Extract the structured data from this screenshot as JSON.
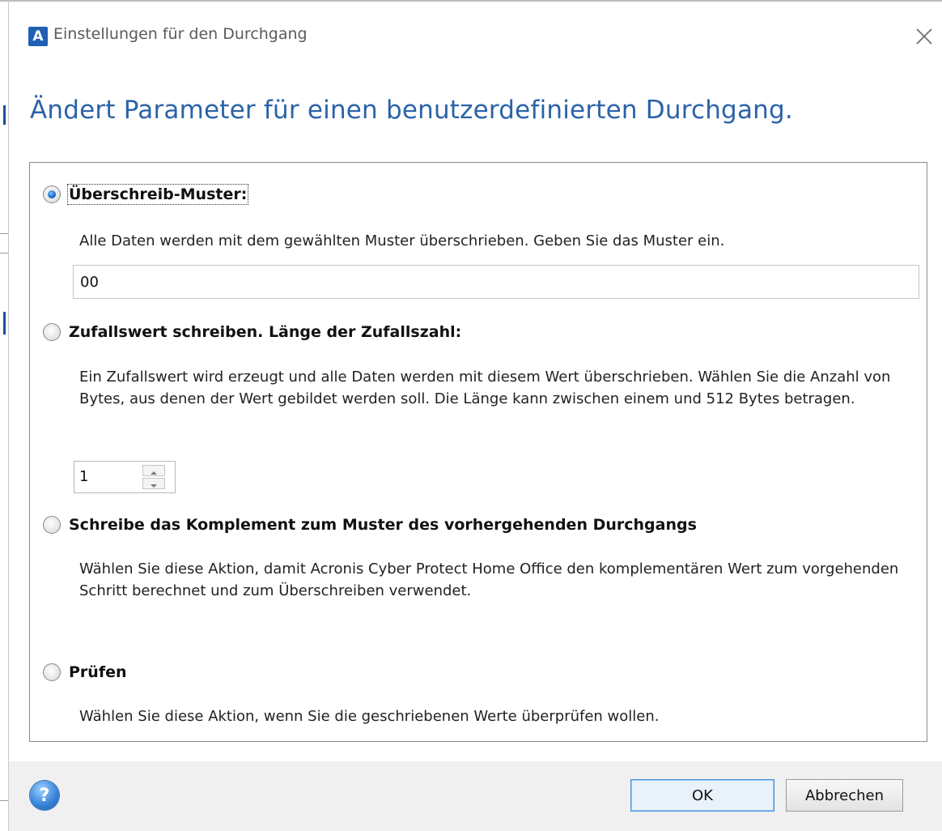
{
  "window": {
    "app_icon_letter": "A",
    "title": "Einstellungen für den Durchgang",
    "close_glyph": "×"
  },
  "heading": "Ändert Parameter für einen benutzerdefinierten Durchgang.",
  "options": [
    {
      "label": "Überschreib-Muster:",
      "selected": true,
      "description": "Alle Daten werden mit dem gewählten Muster überschrieben. Geben Sie das Muster ein."
    },
    {
      "label": "Zufallswert schreiben. Länge der Zufallszahl:",
      "selected": false,
      "description": "Ein Zufallswert wird erzeugt und alle Daten werden mit diesem Wert überschrieben. Wählen Sie die Anzahl von Bytes, aus denen der Wert gebildet werden soll. Die Länge kann zwischen einem und 512 Bytes betragen."
    },
    {
      "label": "Schreibe das Komplement zum Muster des vorhergehenden Durchgangs",
      "selected": false,
      "description": "Wählen Sie diese Aktion, damit Acronis Cyber Protect Home Office den komplementären Wert zum vorgehenden Schritt berechnet und zum Überschreiben verwendet."
    },
    {
      "label": "Prüfen",
      "selected": false,
      "description": "Wählen Sie diese Aktion, wenn Sie die geschriebenen Werte überprüfen wollen."
    }
  ],
  "pattern_input": {
    "value": "00"
  },
  "random_length_spinner": {
    "value": "1"
  },
  "footer": {
    "help_glyph": "?",
    "ok_label": "OK",
    "cancel_label": "Abbrechen"
  },
  "colors": {
    "heading": "#2a63a8",
    "accent": "#1f5fb4",
    "footer_bg": "#f0f0f0"
  }
}
